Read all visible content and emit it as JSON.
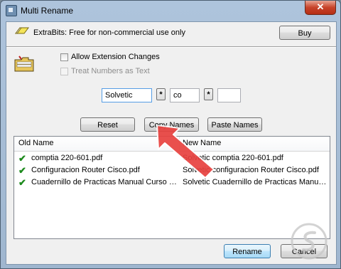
{
  "window": {
    "title": "Multi Rename",
    "close_label": "✕"
  },
  "banner": {
    "text": "ExtraBits: Free for non-commercial use only",
    "buy_label": "Buy"
  },
  "options": {
    "allow_extension_label": "Allow Extension Changes",
    "allow_extension_checked": false,
    "treat_numbers_label": "Treat Numbers as Text",
    "treat_numbers_checked": false
  },
  "pattern": {
    "prefix_value": "Solvetic",
    "wildcard1": "*",
    "middle_value": "co",
    "wildcard2": "*",
    "suffix_value": ""
  },
  "actions": {
    "reset_label": "Reset",
    "copy_names_label": "Copy Names",
    "paste_names_label": "Paste Names"
  },
  "file_list": {
    "columns": [
      "Old Name",
      "New Name"
    ],
    "rows": [
      {
        "checked": true,
        "old": "comptia 220-601.pdf",
        "new": "Solvetic comptia 220-601.pdf"
      },
      {
        "checked": true,
        "old": "Configuracion Router Cisco.pdf",
        "new": "Solvetic configuracion Router Cisco.pdf"
      },
      {
        "checked": true,
        "old": "Cuadernillo de Practicas Manual Curso Basic...",
        "new": "Solvetic Cuadernillo de Practicas Manual C..."
      }
    ]
  },
  "footer": {
    "rename_label": "Rename",
    "cancel_label": "Cancel"
  },
  "icons": {
    "banner_icon": "eraser-pencil-icon",
    "folder_icon": "folder-icon",
    "check_icon": "checkmark-icon",
    "annotation": "red-arrow-annotation"
  },
  "colors": {
    "accent": "#3c7fb1",
    "check": "#1d8a1d",
    "arrow": "#e8423f"
  }
}
